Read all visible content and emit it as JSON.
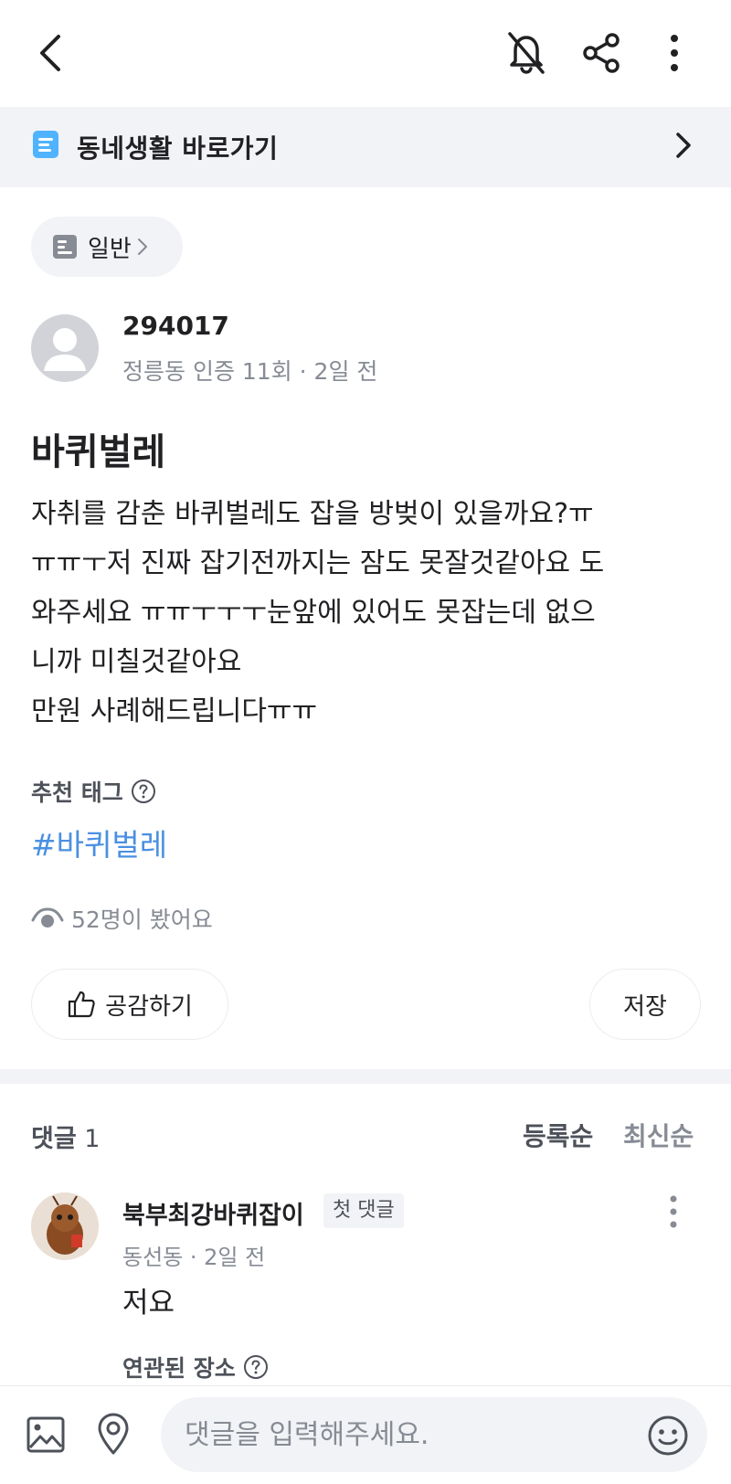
{
  "header": {
    "back_icon": "chevron-left-icon",
    "notification_off_icon": "bell-off-icon",
    "share_icon": "share-icon",
    "more_icon": "more-vertical-icon"
  },
  "neighborhood": {
    "label": "동네생활 바로가기",
    "icon": "board-icon",
    "accent_color": "#4fb3ff"
  },
  "category": {
    "label": "일반"
  },
  "author": {
    "name": "294017",
    "meta": "정릉동 인증 11회 · 2일 전"
  },
  "post": {
    "title": "바퀴벌레",
    "body": "자취를 감춘 바퀴벌레도 잡을 방벚이 있을까요?ㅠ\nㅠㅠㅜ저 진짜 잡기전까지는 잠도 못잘것같아요 도\n와주세요 ㅠㅠㅜㅜㅜ눈앞에 있어도 못잡는데 없으\n니까 미칠것같아요\n만원 사례해드립니다ㅠㅠ"
  },
  "tags": {
    "heading": "추천 태그",
    "items": [
      "#바퀴벌레"
    ],
    "link_color": "#4a90e2"
  },
  "views": {
    "label": "52명이 봤어요"
  },
  "actions": {
    "like_label": "공감하기",
    "save_label": "저장"
  },
  "comments": {
    "heading": "댓글",
    "count": "1",
    "sort_registered": "등록순",
    "sort_latest": "최신순",
    "items": [
      {
        "name": "북부최강바퀴잡이",
        "badge": "첫 댓글",
        "meta": "동선동 · 2일 전",
        "text": "저요",
        "place_heading": "연관된 장소"
      }
    ]
  },
  "composer": {
    "placeholder": "댓글을 입력해주세요.",
    "image_icon": "image-icon",
    "location_icon": "location-pin-icon",
    "emoji_icon": "smiley-icon"
  }
}
